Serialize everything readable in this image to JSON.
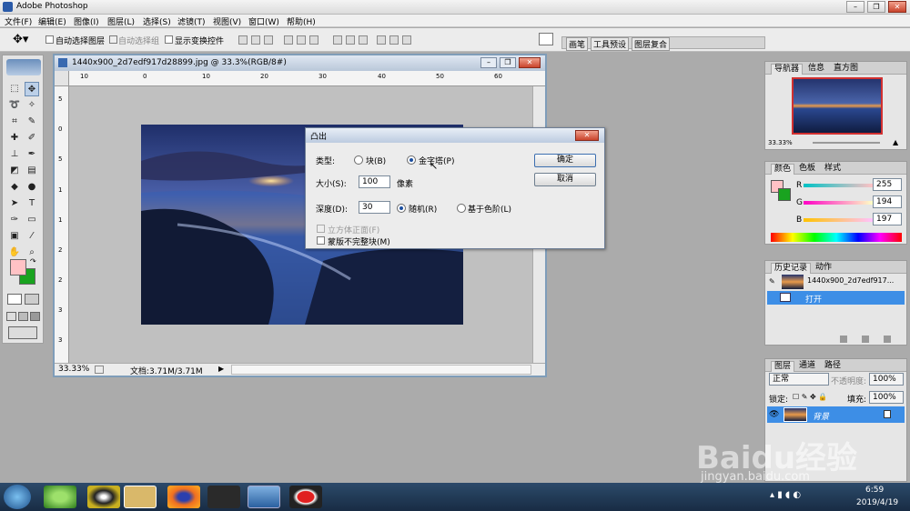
{
  "app": {
    "title": "Adobe Photoshop"
  },
  "window_controls": {
    "minimize": "–",
    "restore": "❐",
    "close": "✕"
  },
  "menu": [
    "文件(F)",
    "编辑(E)",
    "图像(I)",
    "图层(L)",
    "选择(S)",
    "滤镜(T)",
    "视图(V)",
    "窗口(W)",
    "帮助(H)"
  ],
  "options": {
    "auto_select_layer": "自动选择图层",
    "auto_select_group": "自动选择组",
    "show_transform": "显示变换控件",
    "tabs": [
      "画笔",
      "工具预设",
      "图层复合"
    ]
  },
  "document": {
    "title": "1440x900_2d7edf917d28899.jpg @ 33.3%(RGB/8#)",
    "zoom": "33.33%",
    "doc_info": "文档:3.71M/3.71M",
    "ruler_h": [
      "10",
      "0",
      "10",
      "20",
      "30",
      "40",
      "50",
      "60"
    ],
    "ruler_v": [
      "5",
      "0",
      "5",
      "1",
      "1",
      "2",
      "2",
      "3",
      "3"
    ]
  },
  "dialog": {
    "title": "凸出",
    "type_label": "类型:",
    "opt_block": "块(B)",
    "opt_pyramid": "金字塔(P)",
    "size_label": "大小(S):",
    "size_value": "100",
    "size_unit": "像素",
    "depth_label": "深度(D):",
    "depth_value": "30",
    "opt_random": "随机(R)",
    "opt_level": "基于色阶(L)",
    "chk_solid": "立方体正面(F)",
    "chk_mask": "蒙版不完整块(M)",
    "ok": "确定",
    "cancel": "取消"
  },
  "navigator": {
    "tabs": [
      "导航器",
      "信息",
      "直方图"
    ],
    "zoom": "33.33%"
  },
  "color": {
    "tabs": [
      "颜色",
      "色板",
      "样式"
    ],
    "r_label": "R",
    "r": "255",
    "g_label": "G",
    "g": "194",
    "b_label": "B",
    "b": "197",
    "fg": "#ffc2c5",
    "bg": "#19a31f"
  },
  "history": {
    "tabs": [
      "历史记录",
      "动作"
    ],
    "snapshot": "1440x900_2d7edf917...",
    "item": "打开"
  },
  "layers": {
    "tabs": [
      "图层",
      "通道",
      "路径"
    ],
    "mode": "正常",
    "opacity_label": "不透明度:",
    "opacity": "100%",
    "lock_label": "锁定:",
    "fill_label": "填充:",
    "fill": "100%",
    "layer_name": "背景"
  },
  "taskbar": {
    "time": "6:59",
    "date": "2019/4/19"
  },
  "watermark": {
    "text": "Baidu经验",
    "url": "jingyan.baidu.com"
  }
}
